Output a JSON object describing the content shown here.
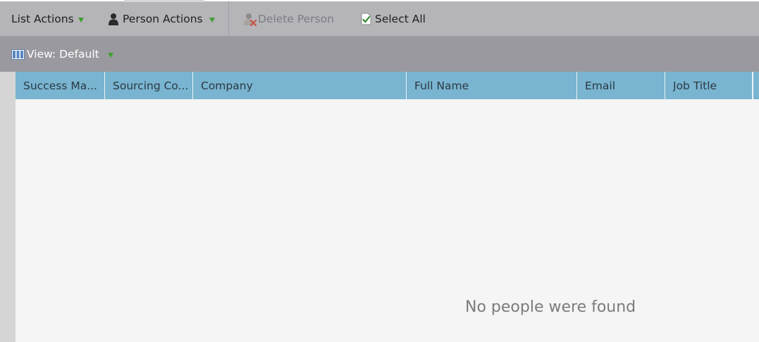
{
  "toolbar": {
    "list_actions": "List Actions",
    "person_actions": "Person Actions",
    "delete_person": "Delete Person",
    "select_all": "Select All"
  },
  "view": {
    "label": "View: Default"
  },
  "grid": {
    "columns": [
      "Success Ma...",
      "Sourcing Co...",
      "Company",
      "Full Name",
      "Email",
      "Job Title"
    ],
    "empty_message": "No people were found"
  },
  "icons": {
    "person": "person-icon",
    "delete_person": "delete-person-icon",
    "select_all": "checkbox-page-icon",
    "view": "columns-view-icon",
    "dropdown": "dropdown-caret-icon"
  },
  "colors": {
    "toolbar_bg": "#b5b4b9",
    "viewbar_bg": "#9a999f",
    "header_bg": "#79b4d1",
    "grid_bg": "#f5f5f5",
    "caret": "#3f9f2f"
  }
}
